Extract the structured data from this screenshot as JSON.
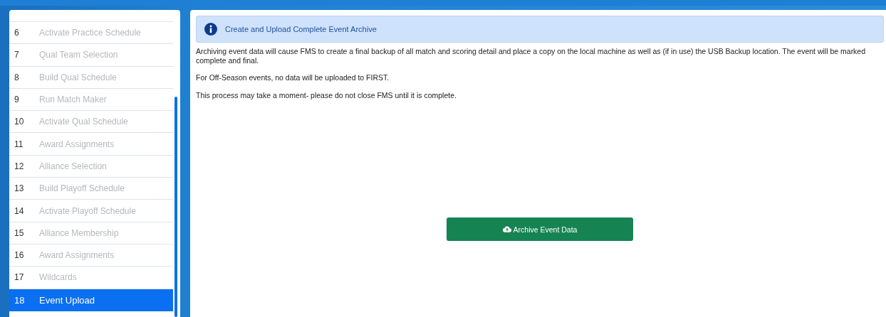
{
  "sidebar": {
    "items": [
      {
        "number": "6",
        "label": "Activate Practice Schedule",
        "disabled": true,
        "selected": false
      },
      {
        "number": "7",
        "label": "Qual Team Selection",
        "disabled": true,
        "selected": false
      },
      {
        "number": "8",
        "label": "Build Qual Schedule",
        "disabled": true,
        "selected": false
      },
      {
        "number": "9",
        "label": "Run Match Maker",
        "disabled": true,
        "selected": false
      },
      {
        "number": "10",
        "label": "Activate Qual Schedule",
        "disabled": true,
        "selected": false
      },
      {
        "number": "11",
        "label": "Award Assignments",
        "disabled": true,
        "selected": false
      },
      {
        "number": "12",
        "label": "Alliance Selection",
        "disabled": true,
        "selected": false
      },
      {
        "number": "13",
        "label": "Build Playoff Schedule",
        "disabled": true,
        "selected": false
      },
      {
        "number": "14",
        "label": "Activate Playoff Schedule",
        "disabled": true,
        "selected": false
      },
      {
        "number": "15",
        "label": "Alliance Membership",
        "disabled": true,
        "selected": false
      },
      {
        "number": "16",
        "label": "Award Assignments",
        "disabled": true,
        "selected": false
      },
      {
        "number": "17",
        "label": "Wildcards",
        "disabled": true,
        "selected": false
      },
      {
        "number": "18",
        "label": "Event Upload",
        "disabled": false,
        "selected": true
      }
    ]
  },
  "main": {
    "alert": "Create and Upload Complete Event Archive",
    "paragraphs": [
      "Archiving event data will cause FMS to create a final backup of all match and scoring detail and place a copy on the local machine as well as (if in use) the USB Backup location. The event will be marked complete and final.",
      "For Off-Season events, no data will be uploaded to FIRST.",
      "This process may take a moment- please do not close FMS until it is complete."
    ],
    "button": "Archive Event Data"
  }
}
